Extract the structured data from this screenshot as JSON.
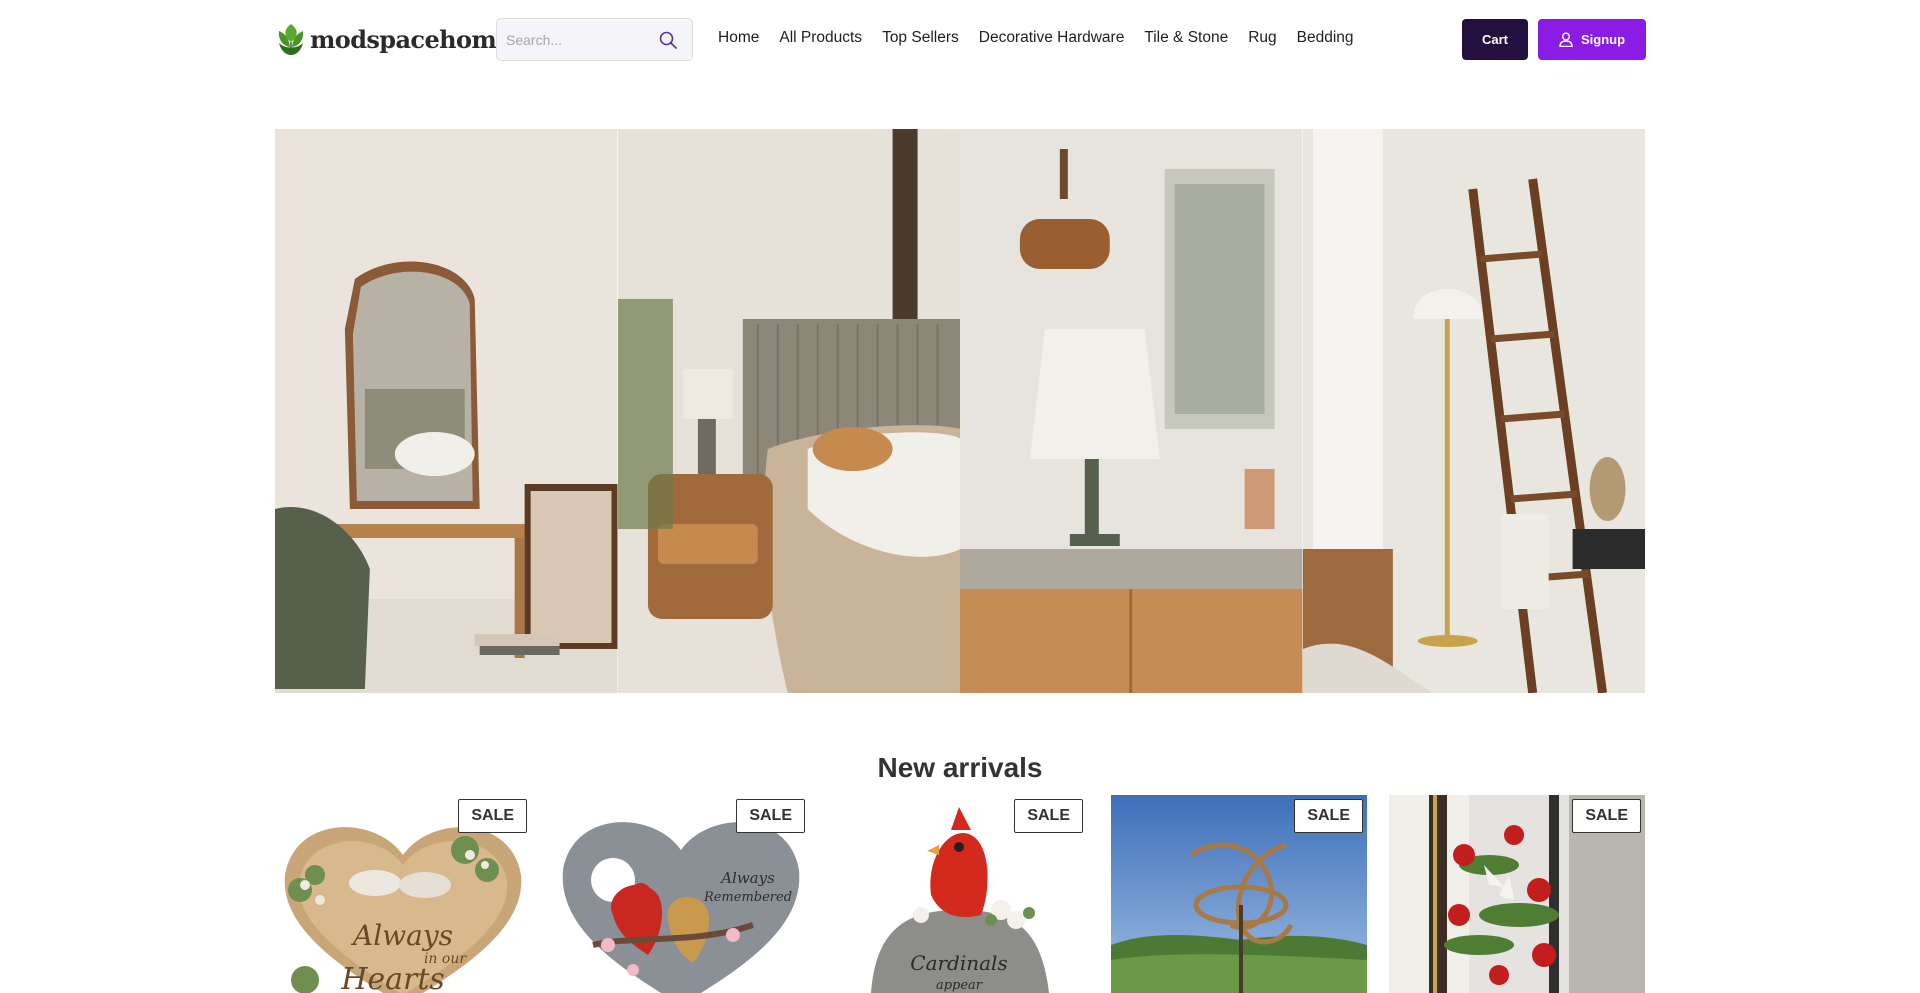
{
  "brand": {
    "name": "modspacehome",
    "logo_icon": "leaf-icon",
    "logo_color": "#4f9b2e"
  },
  "search": {
    "placeholder": "Search...",
    "icon": "search-icon"
  },
  "nav": {
    "items": [
      {
        "label": "Home"
      },
      {
        "label": "All Products"
      },
      {
        "label": "Top Sellers"
      },
      {
        "label": "Decorative Hardware"
      },
      {
        "label": "Tile & Stone"
      },
      {
        "label": "Rug"
      },
      {
        "label": "Bedding"
      }
    ]
  },
  "actions": {
    "cart_label": "Cart",
    "cart_color": "#23103f",
    "signup_label": "Signup",
    "signup_icon": "user-icon",
    "signup_color": "#8a1ce6"
  },
  "hero": {
    "panels": [
      {
        "scene": "mirror-bench"
      },
      {
        "scene": "bed-nightstand"
      },
      {
        "scene": "lamp-cabinet"
      },
      {
        "scene": "ladder-floor-lamp"
      }
    ]
  },
  "new_arrivals": {
    "title": "New arrivals",
    "products": [
      {
        "badge": "SALE",
        "image": "memorial-stone-doves",
        "image_text_1": "Always",
        "image_text_2": "in our",
        "image_text_3": "Hearts"
      },
      {
        "badge": "SALE",
        "image": "memorial-stone-cardinals",
        "image_text_1": "Always",
        "image_text_2": "Remembered"
      },
      {
        "badge": "SALE",
        "image": "cardinal-rock",
        "image_text_1": "Cardinals",
        "image_text_2": "appear"
      },
      {
        "badge": "SALE",
        "image": "wind-spinner"
      },
      {
        "badge": "SALE",
        "image": "flower-arrangement"
      }
    ]
  }
}
